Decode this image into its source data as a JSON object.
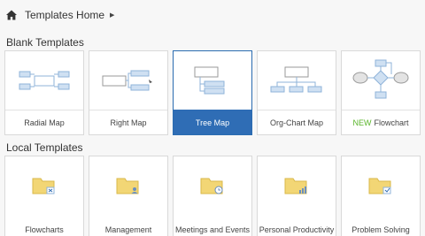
{
  "breadcrumb": {
    "label": "Templates Home"
  },
  "blank": {
    "title": "Blank Templates",
    "tiles": [
      {
        "label": "Radial Map"
      },
      {
        "label": "Right Map"
      },
      {
        "label": "Tree Map"
      },
      {
        "label": "Org-Chart Map"
      },
      {
        "new_tag": "NEW",
        "label": "Flowchart"
      }
    ]
  },
  "local": {
    "title": "Local Templates",
    "tiles": [
      {
        "label": "Flowcharts"
      },
      {
        "label": "Management"
      },
      {
        "label": "Meetings and Events"
      },
      {
        "label": "Personal Productivity"
      },
      {
        "label": "Problem Solving"
      }
    ]
  },
  "colors": {
    "selected": "#2f6db5",
    "new_tag": "#5ab52a",
    "folder": "#f2d675",
    "diagram": "#8fb3d9"
  }
}
